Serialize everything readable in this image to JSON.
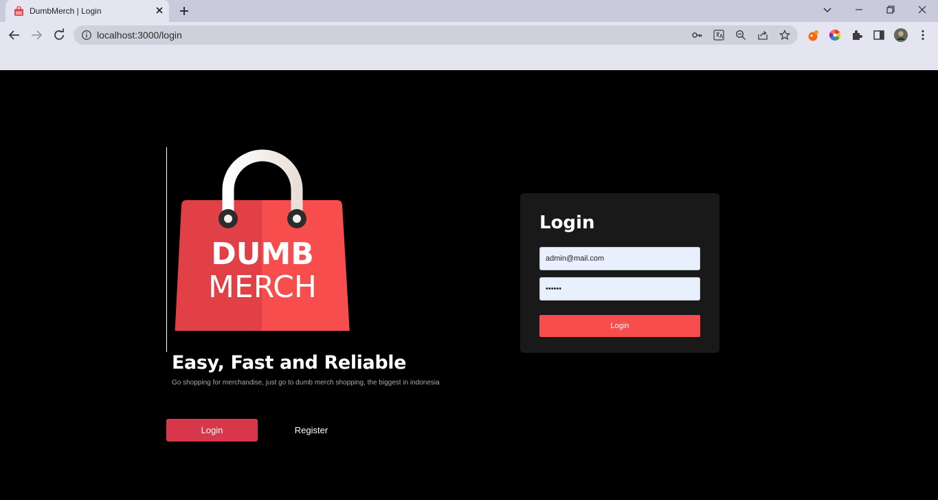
{
  "browser": {
    "tab_title": "DumbMerch | Login",
    "url": "localhost:3000/login"
  },
  "hero": {
    "logo_line1": "DUMB",
    "logo_line2": "MERCH",
    "tagline": "Easy, Fast and Reliable",
    "subtitle": "Go shopping for merchandise, just go to dumb merch shopping, the biggest in indonesia",
    "login_label": "Login",
    "register_label": "Register"
  },
  "login_form": {
    "title": "Login",
    "email_value": "admin@mail.com",
    "password_value": "123456",
    "submit_label": "Login"
  },
  "colors": {
    "accent": "#f74d4d",
    "hero_button": "#d9374b",
    "card_bg": "#191919",
    "page_bg": "#000000"
  }
}
